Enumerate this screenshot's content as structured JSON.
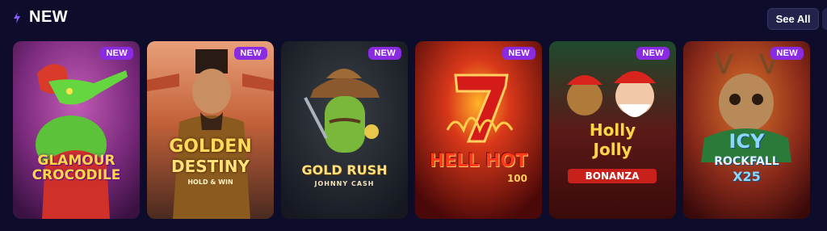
{
  "section": {
    "title": "NEW",
    "see_all_label": "See All"
  },
  "games": [
    {
      "line1": "GLAMOUR",
      "line2": "CROCODILE",
      "badge": "NEW"
    },
    {
      "line1": "GOLDEN",
      "line2": "DESTINY",
      "sub": "HOLD & WIN",
      "badge": "NEW"
    },
    {
      "line1": "GOLD RUSH",
      "line2": "JOHNNY CASH",
      "badge": "NEW"
    },
    {
      "line1": "HELL HOT",
      "line2": "100",
      "badge": "NEW"
    },
    {
      "line1": "Holly",
      "line2": "Jolly",
      "sub": "BONANZA",
      "badge": "NEW"
    },
    {
      "line1": "ICY",
      "line2": "ROCKFALL",
      "sub": "X25",
      "badge": "NEW"
    }
  ],
  "colors": {
    "background": "#0d0d2b",
    "badge": "#8a2be2",
    "accent": "#8a5cff"
  }
}
